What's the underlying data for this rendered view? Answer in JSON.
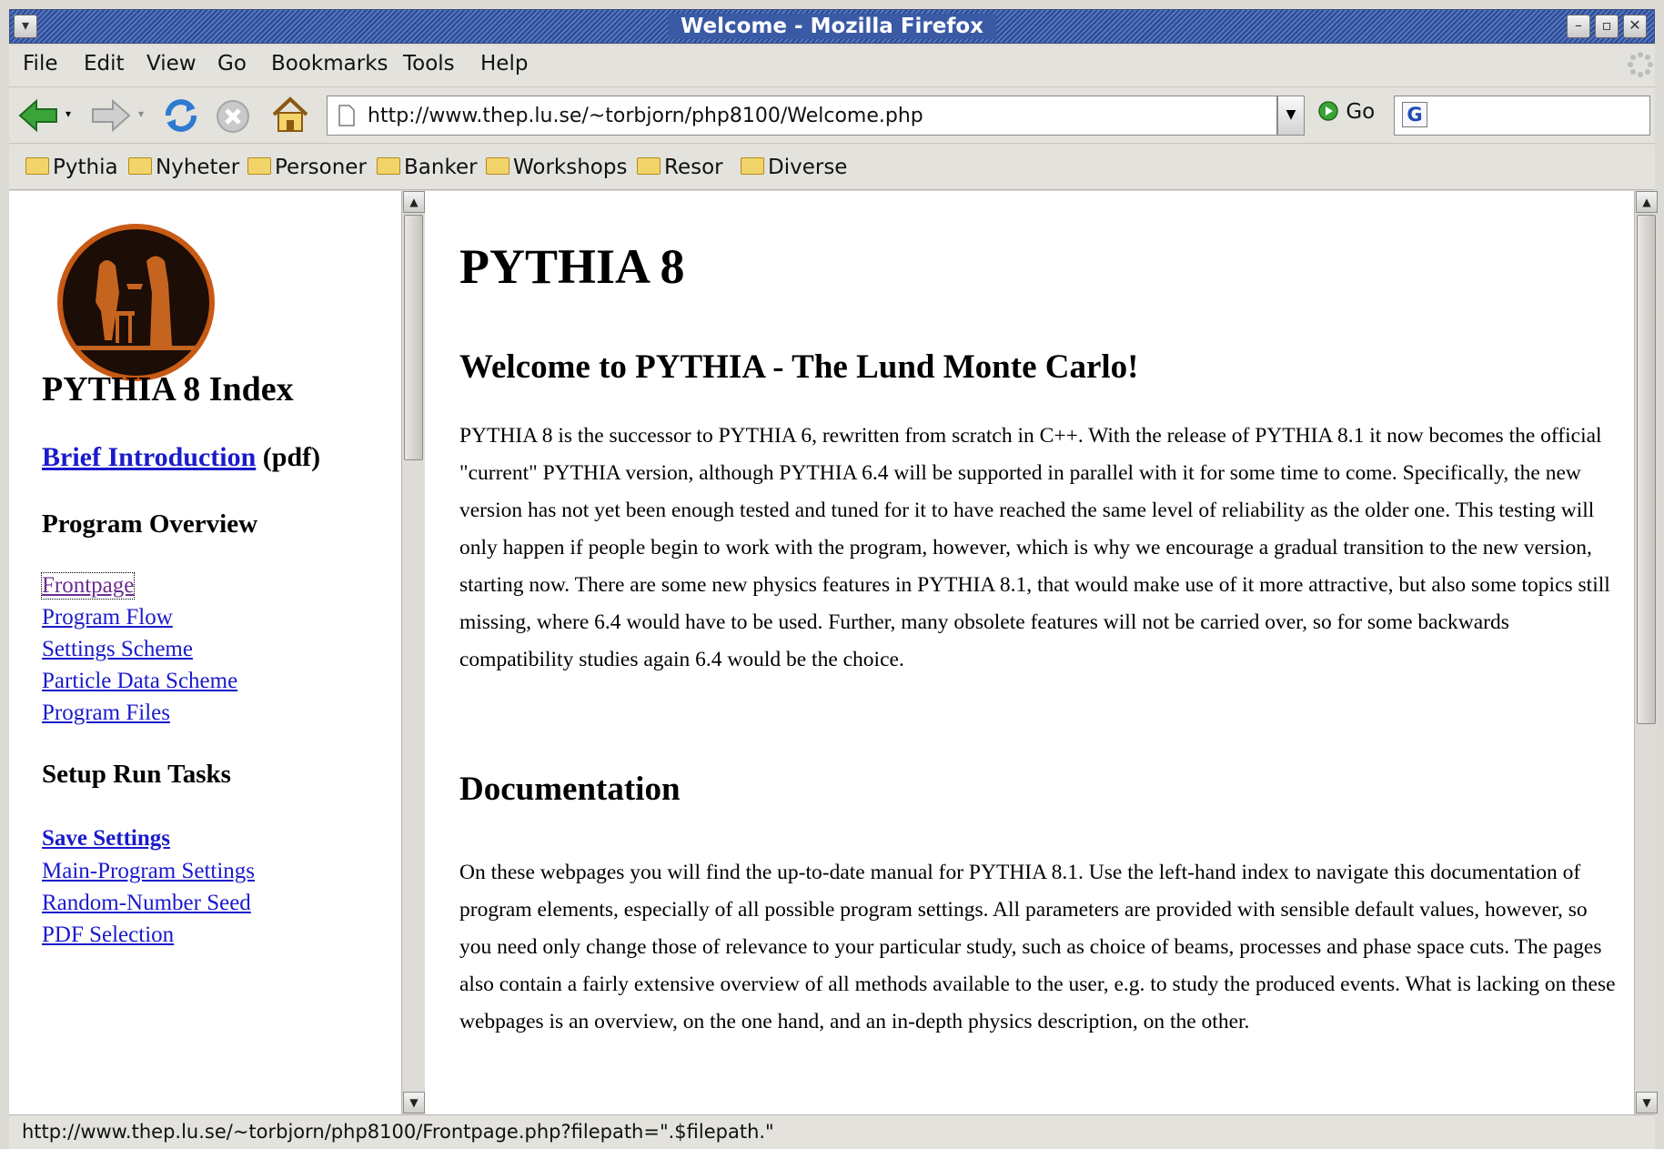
{
  "window": {
    "title": "Welcome - Mozilla Firefox"
  },
  "menu": [
    "File",
    "Edit",
    "View",
    "Go",
    "Bookmarks",
    "Tools",
    "Help"
  ],
  "nav": {
    "url": "http://www.thep.lu.se/~torbjorn/php8100/Welcome.php",
    "go_label": "Go",
    "search_value": ""
  },
  "bookmarks": [
    "Pythia",
    "Nyheter",
    "Personer",
    "Banker",
    "Workshops",
    "Resor",
    "Diverse"
  ],
  "sidebar": {
    "index_title": "PYTHIA 8 Index",
    "brief_link": "Brief Introduction",
    "brief_suffix": "(pdf)",
    "overview_heading": "Program Overview",
    "overview_links": [
      "Frontpage",
      "Program Flow",
      "Settings Scheme",
      "Particle Data Scheme",
      "Program Files"
    ],
    "setup_heading": "Setup Run Tasks",
    "setup_links": [
      "Save Settings",
      "Main-Program Settings",
      "Random-Number Seed",
      "PDF Selection"
    ]
  },
  "main": {
    "h1": "PYTHIA 8",
    "h2": "Welcome to PYTHIA - The Lund Monte Carlo!",
    "p1": "PYTHIA 8 is the successor to PYTHIA 6, rewritten from scratch in C++. With the release of PYTHIA 8.1 it now becomes the official \"current\" PYTHIA version, although PYTHIA 6.4 will be supported in parallel with it for some time to come. Specifically, the new version has not yet been enough tested and tuned for it to have reached the same level of reliability as the older one. This testing will only happen if people begin to work with the program, however, which is why we encourage a gradual transition to the new version, starting now. There are some new physics features in PYTHIA 8.1, that would make use of it more attractive, but also some topics still missing, where 6.4 would have to be used. Further, many obsolete features will not be carried over, so for some backwards compatibility studies again 6.4 would be the choice.",
    "h3": "Documentation",
    "p2": "On these webpages you will find the up-to-date manual for PYTHIA 8.1. Use the left-hand index to navigate this documentation of program elements, especially of all possible program settings. All parameters are provided with sensible default values, however, so you need only change those of relevance to your particular study, such as choice of beams, processes and phase space cuts. The pages also contain a fairly extensive overview of all methods available to the user, e.g. to study the produced events. What is lacking on these webpages is an overview, on the one hand, and an in-depth physics description, on the other."
  },
  "status": {
    "text": "http://www.thep.lu.se/~torbjorn/php8100/Frontpage.php?filepath=\".$filepath.\""
  }
}
